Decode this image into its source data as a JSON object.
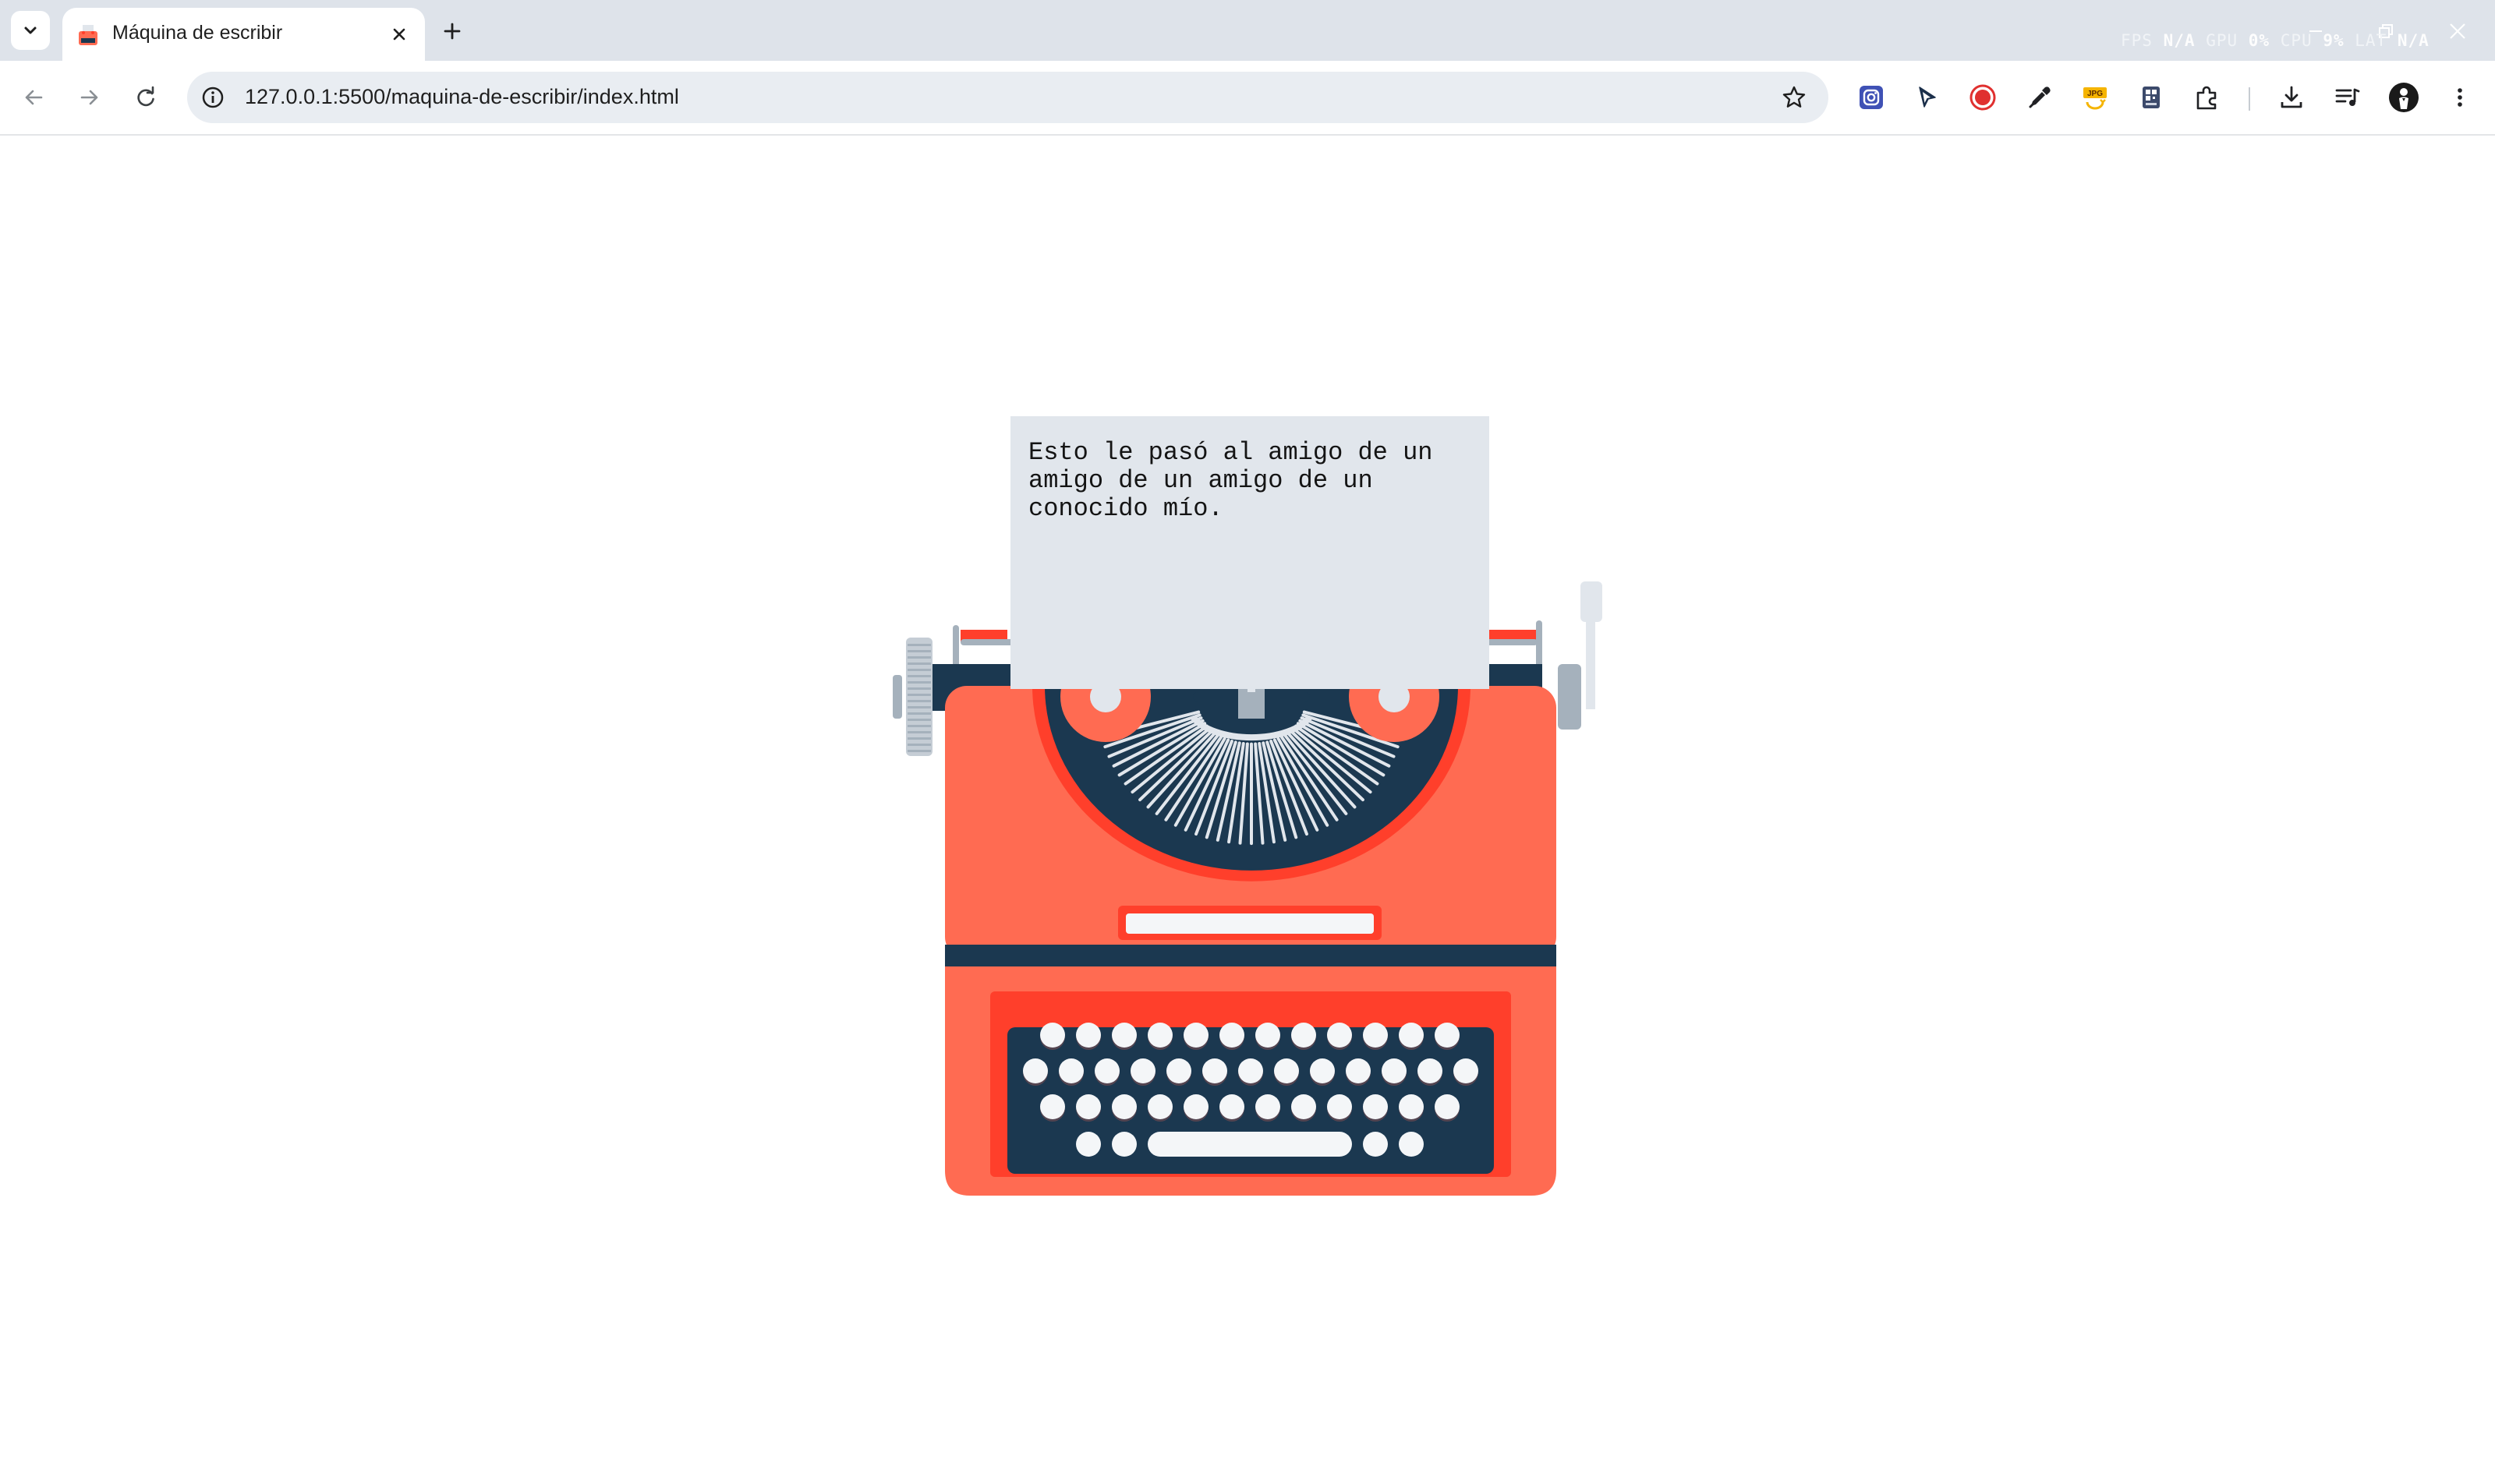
{
  "browser": {
    "tab": {
      "title": "Máquina de escribir",
      "favicon": "typewriter-favicon"
    },
    "new_tab_label": "+",
    "url": "127.0.0.1:5500/maquina-de-escribir/index.html",
    "perf_hud": {
      "fps_label": "FPS",
      "fps_value": "N/A",
      "gpu_label": "GPU",
      "gpu_value": "0%",
      "cpu_label": "CPU",
      "cpu_value": "9%",
      "lat_label": "LAT",
      "lat_value": "N/A"
    },
    "toolbar_icons": [
      "instagram-download-icon",
      "cursor-icon",
      "record-icon",
      "eyedropper-icon",
      "jpg-converter-icon",
      "qr-code-icon",
      "extensions-icon",
      "download-icon",
      "reading-list-icon",
      "profile-avatar-icon",
      "kebab-menu-icon"
    ]
  },
  "page": {
    "paper_text": "Esto le pasó al amigo de un\namigo de un amigo de un\nconocido mío."
  },
  "colors": {
    "body_red": "#ff6b52",
    "dark_red": "#ff3f2b",
    "navy": "#1b3850",
    "paper": "#e1e6ec",
    "key_white": "#f4f6f8",
    "metal_grey": "#a5b1bc"
  }
}
